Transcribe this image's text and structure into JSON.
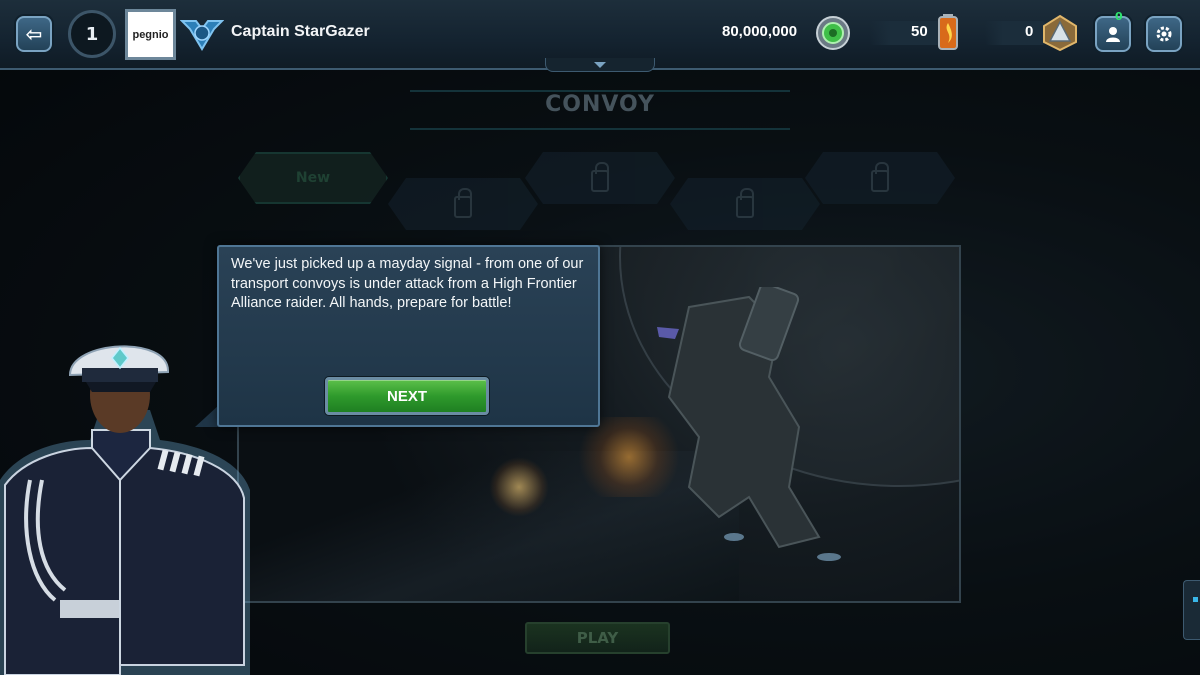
{
  "topbar": {
    "back_icon": "back-arrow-icon",
    "level": "1",
    "avatar_text": "pegnio",
    "rank_icon": "rank-wings-icon",
    "captain_name": "Captain StarGazer",
    "credits": "80,000,000",
    "credits_icon": "credits-gear-icon",
    "fuel": "50",
    "fuel_icon": "fuel-canister-icon",
    "medals": "0",
    "medal_icon": "medal-triangle-icon",
    "friends_count": "0",
    "friends_icon": "friends-icon",
    "settings_icon": "settings-gear-icon"
  },
  "convoy": {
    "title": "CONVOY",
    "nodes": [
      {
        "label": "New",
        "locked": false
      },
      {
        "label": "",
        "locked": true
      },
      {
        "label": "",
        "locked": true
      },
      {
        "label": "",
        "locked": true
      },
      {
        "label": "",
        "locked": true
      }
    ]
  },
  "dialog": {
    "text": "We've just picked up a mayday signal -  from one of our transport convoys is under attack from a High Frontier Alliance raider.  All hands, prepare for battle!",
    "next_label": "NEXT"
  },
  "mission": {
    "play_label": "PLAY"
  },
  "colors": {
    "accent_green": "#2f9a2c",
    "frame_blue": "#4f7695",
    "topbar_bg": "#142330"
  }
}
